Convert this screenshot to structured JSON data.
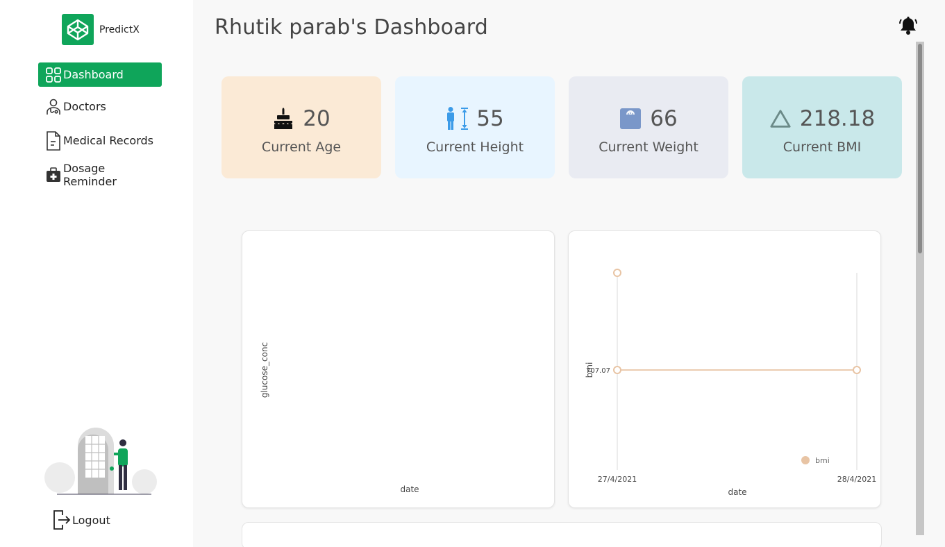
{
  "brand": {
    "name": "PredictX",
    "logo_icon": "codepen-cube-icon",
    "color": "#0fa55a"
  },
  "sidebar": {
    "items": [
      {
        "label": "Dashboard",
        "icon": "grid-icon",
        "active": true
      },
      {
        "label": "Doctors",
        "icon": "doctor-icon",
        "active": false
      },
      {
        "label": "Medical Records",
        "icon": "document-icon",
        "active": false
      },
      {
        "label": "Dosage Reminder",
        "icon": "medical-kit-icon",
        "active": false
      }
    ],
    "logout_label": "Logout"
  },
  "header": {
    "title": "Rhutik parab's Dashboard",
    "bell_icon": "bell-icon"
  },
  "stats": [
    {
      "value": "20",
      "label": "Current Age",
      "icon": "cake-icon",
      "bg": "#fbead6"
    },
    {
      "value": "55",
      "label": "Current Height",
      "icon": "height-icon",
      "bg": "#e8f5ff"
    },
    {
      "value": "66",
      "label": "Current Weight",
      "icon": "scale-icon",
      "bg": "#e9ebf2"
    },
    {
      "value": "218.18",
      "label": "Current BMI",
      "icon": "triangle-icon",
      "bg": "#c9e8ea"
    }
  ],
  "chart_data": [
    {
      "type": "scatter",
      "title": "",
      "xlabel": "date",
      "ylabel": "glucose_conc",
      "series": []
    },
    {
      "type": "line",
      "title": "",
      "xlabel": "date",
      "ylabel": "bmi",
      "x": [
        "27/4/2021",
        "28/4/2021"
      ],
      "x_ticks": [
        "27/4/2021",
        "28/4/2021"
      ],
      "y_ticks": [
        "707.07"
      ],
      "series": [
        {
          "name": "bmi",
          "x": [
            "27/4/2021",
            "28/4/2021"
          ],
          "values": [
            707.07,
            707.07
          ],
          "color": "#e8c4a4"
        },
        {
          "name": "",
          "x": [
            "27/4/2021"
          ],
          "values": [
            1414.14
          ],
          "color": "#e8c4a4"
        }
      ],
      "ylim": [
        0,
        1414.14
      ],
      "legend": "bottom-right",
      "grid": true
    }
  ]
}
